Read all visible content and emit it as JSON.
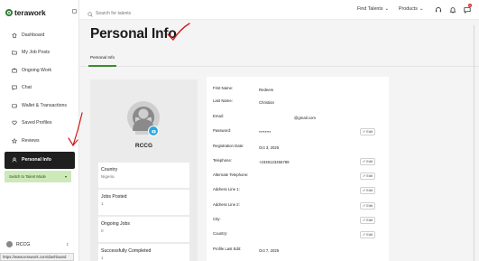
{
  "brand": {
    "name": "terawork"
  },
  "sidebar": {
    "items": [
      {
        "label": "Dashboard",
        "icon": "home-icon"
      },
      {
        "label": "My Job Posts",
        "icon": "folder-icon"
      },
      {
        "label": "Ongoing Work",
        "icon": "briefcase-icon"
      },
      {
        "label": "Chat",
        "icon": "chat-icon"
      },
      {
        "label": "Wallet & Transactions",
        "icon": "wallet-icon"
      },
      {
        "label": "Saved Profiles",
        "icon": "heart-icon"
      },
      {
        "label": "Reviews",
        "icon": "star-icon"
      },
      {
        "label": "Personal Info",
        "icon": "user-icon",
        "active": true
      }
    ],
    "switch_label": "Switch to Talent Mode",
    "account_name": "RCCG"
  },
  "status_url": "https://www.terawork.com/dashboard",
  "topbar": {
    "search_placeholder": "Search for talents",
    "find_talents": "Find Talents",
    "products": "Products",
    "notification_count": "1"
  },
  "page": {
    "title": "Personal Info",
    "tab": "Personal Info"
  },
  "profile": {
    "name": "RCCG",
    "stats": [
      {
        "label": "Country",
        "value": "Nigeria"
      },
      {
        "label": "Jobs Posted",
        "value": "1"
      },
      {
        "label": "Ongoing Jobs",
        "value": "0"
      },
      {
        "label": "Successfully Completed",
        "value": "1"
      }
    ]
  },
  "details": {
    "edit_label": "Edit",
    "rows": [
      {
        "label": "First Name:",
        "value": "Redeem",
        "editable": false
      },
      {
        "label": "Last Name:",
        "value": "Christian",
        "editable": false
      },
      {
        "label": "Email:",
        "value": "@gmail.com",
        "editable": false
      },
      {
        "label": "Password:",
        "value": "********",
        "editable": true
      },
      {
        "label": "Registration Date:",
        "value": "Oct 3, 2025",
        "editable": false
      },
      {
        "label": "Telephone:",
        "value": "+2349123456789",
        "editable": true
      },
      {
        "label": "Alternate Telephone:",
        "value": "",
        "editable": true
      },
      {
        "label": "Address Line 1:",
        "value": "",
        "editable": true
      },
      {
        "label": "Address Line 2:",
        "value": "",
        "editable": true
      },
      {
        "label": "City:",
        "value": "",
        "editable": true
      },
      {
        "label": "Country:",
        "value": "",
        "editable": true
      },
      {
        "label": "Profile Last Edit:",
        "value": "Oct 7, 2025",
        "editable": false
      }
    ]
  },
  "colors": {
    "accent_green": "#3c8d2e",
    "switch_bg": "#cde9b9",
    "annotation_red": "#d11a1a",
    "edit_badge": "#29a8e0"
  }
}
